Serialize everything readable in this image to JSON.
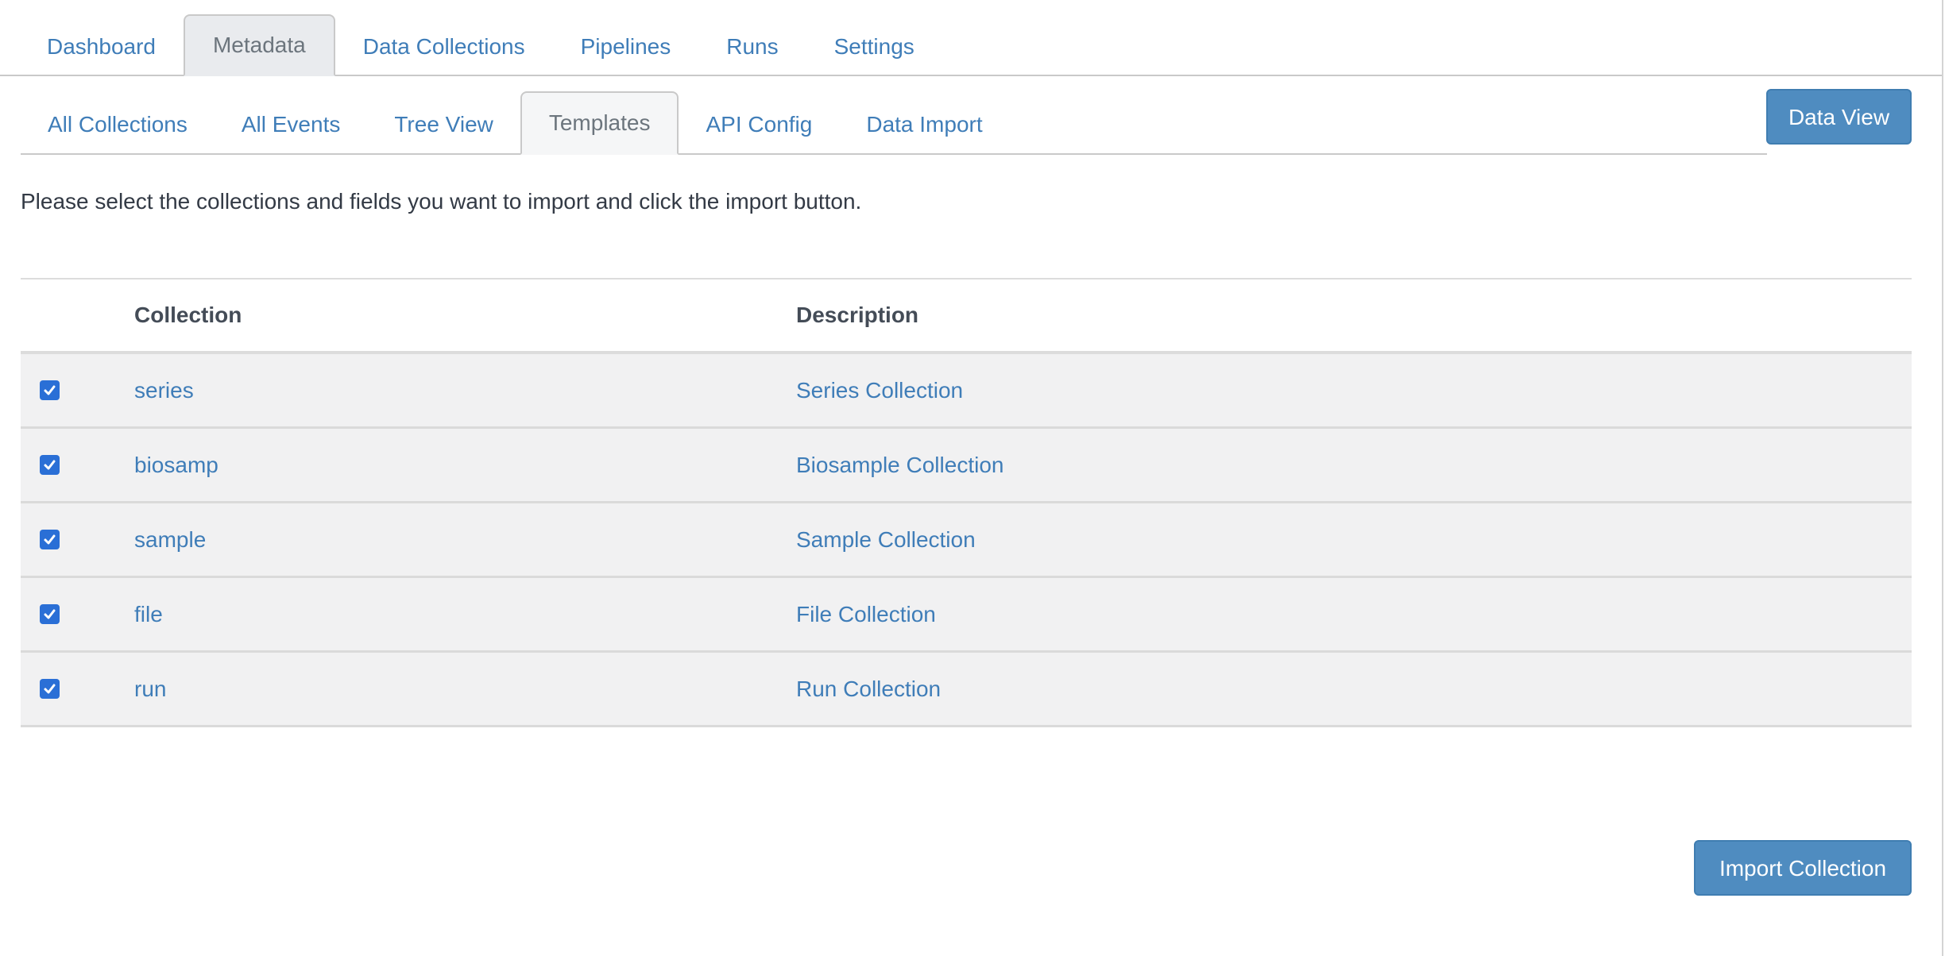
{
  "main_tabs": [
    {
      "label": "Dashboard",
      "active": false
    },
    {
      "label": "Metadata",
      "active": true
    },
    {
      "label": "Data Collections",
      "active": false
    },
    {
      "label": "Pipelines",
      "active": false
    },
    {
      "label": "Runs",
      "active": false
    },
    {
      "label": "Settings",
      "active": false
    }
  ],
  "sub_tabs": [
    {
      "label": "All Collections",
      "active": false
    },
    {
      "label": "All Events",
      "active": false
    },
    {
      "label": "Tree View",
      "active": false
    },
    {
      "label": "Templates",
      "active": true
    },
    {
      "label": "API Config",
      "active": false
    },
    {
      "label": "Data Import",
      "active": false
    }
  ],
  "data_view_label": "Data View",
  "instructions": "Please select the collections and fields you want to import and click the import button.",
  "table": {
    "headers": [
      "Collection",
      "Description"
    ],
    "rows": [
      {
        "checked": true,
        "collection": "series",
        "description": "Series Collection"
      },
      {
        "checked": true,
        "collection": "biosamp",
        "description": "Biosample Collection"
      },
      {
        "checked": true,
        "collection": "sample",
        "description": "Sample Collection"
      },
      {
        "checked": true,
        "collection": "file",
        "description": "File Collection"
      },
      {
        "checked": true,
        "collection": "run",
        "description": "Run Collection"
      }
    ]
  },
  "import_button_label": "Import Collection",
  "colors": {
    "link": "#3f7db8",
    "button": "#4f8cc0",
    "checkbox": "#2a6fd6",
    "row_bg": "#f1f1f2"
  }
}
